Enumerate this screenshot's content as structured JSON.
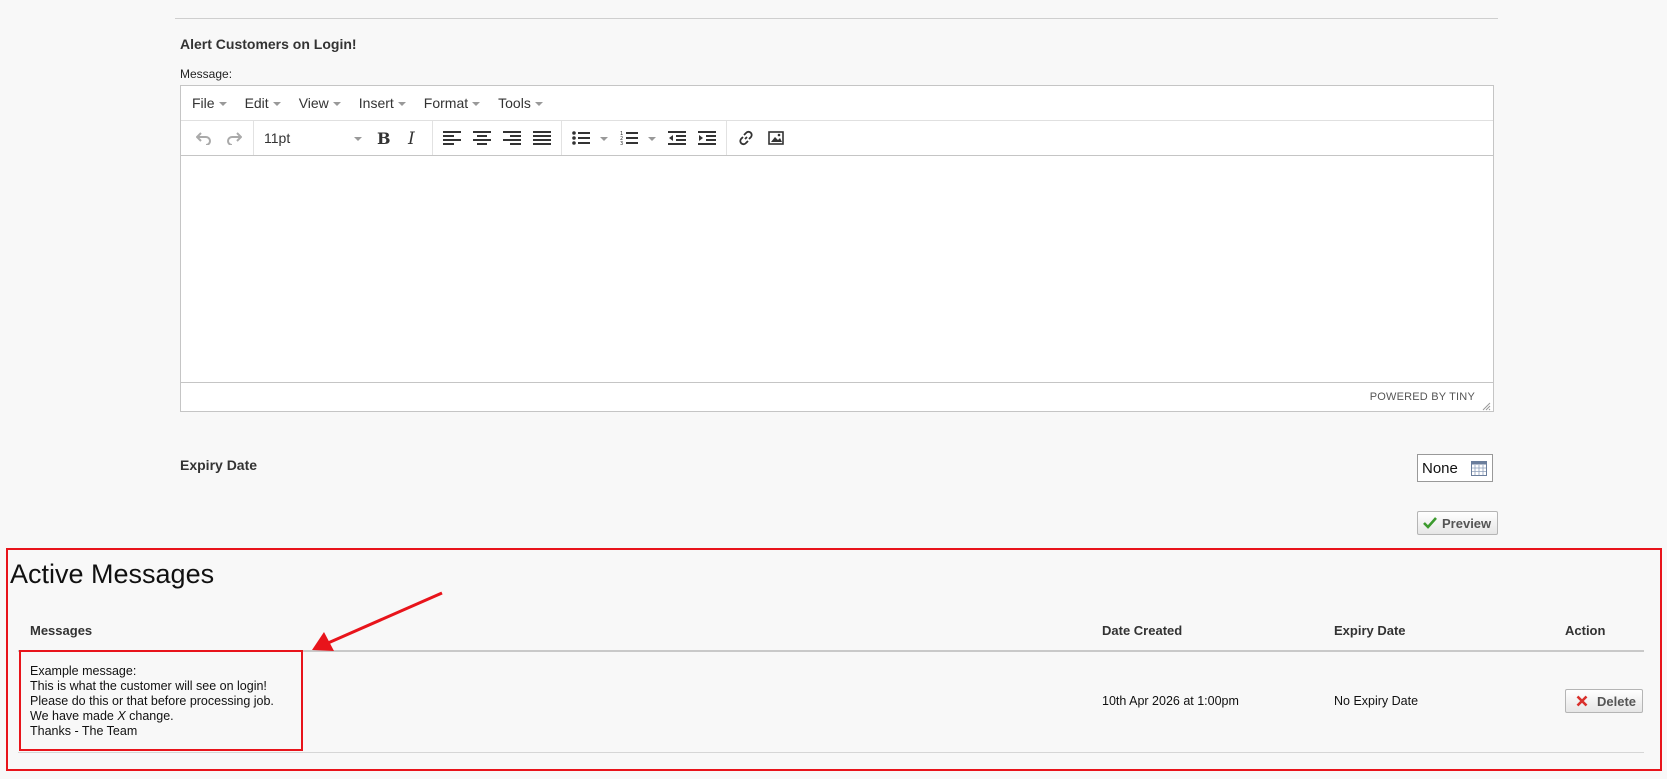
{
  "section": {
    "title": "Alert Customers on Login!",
    "message_label": "Message:"
  },
  "editor": {
    "menu": [
      "File",
      "Edit",
      "View",
      "Insert",
      "Format",
      "Tools"
    ],
    "font_size": "11pt",
    "branding": "POWERED BY TINY"
  },
  "expiry": {
    "label": "Expiry Date",
    "value": "None"
  },
  "preview_button": "Preview",
  "active": {
    "title": "Active Messages",
    "columns": {
      "messages": "Messages",
      "date_created": "Date Created",
      "expiry_date": "Expiry Date",
      "action": "Action"
    },
    "rows": [
      {
        "message_lines": {
          "l1": "Example message:",
          "l2": "This is what the customer will see on login!",
          "l3": "Please do this or that before processing job.",
          "l4_pre": "We have made ",
          "l4_em": "X",
          "l4_post": " change.",
          "l5": "Thanks - The Team"
        },
        "date_created": "10th Apr 2026 at 1:00pm",
        "expiry_date": "No Expiry Date",
        "action_label": "Delete"
      }
    ]
  },
  "colors": {
    "highlight": "#e8141b",
    "background": "#f8f8f8"
  }
}
